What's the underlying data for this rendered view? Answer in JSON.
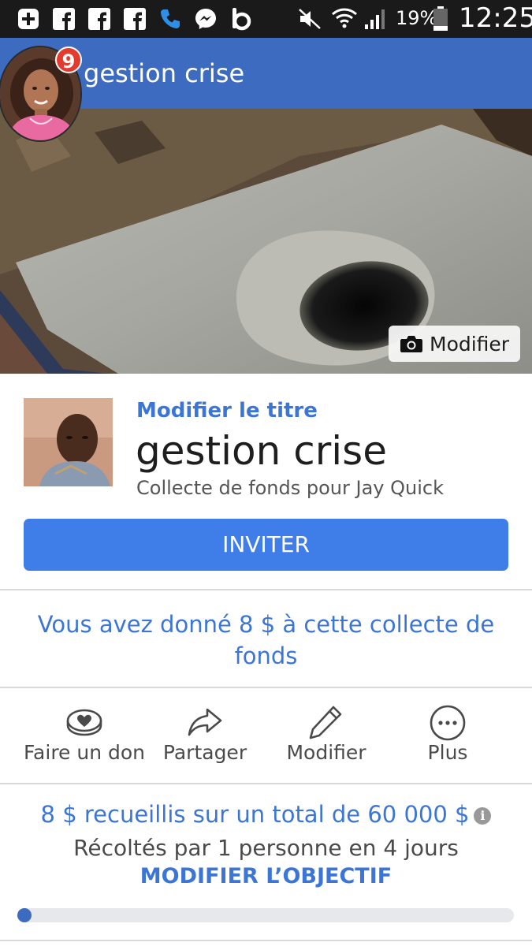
{
  "status_bar": {
    "battery": "19%",
    "time": "12:25",
    "icons": [
      "add-icon",
      "facebook-icon",
      "facebook-icon",
      "facebook-icon",
      "phone-icon",
      "messenger-icon",
      "b-app-icon",
      "mute-icon",
      "wifi-icon",
      "signal-icon",
      "battery-icon"
    ]
  },
  "header": {
    "title": "gestion crise",
    "badge_count": "9"
  },
  "cover": {
    "edit_label": "Modifier"
  },
  "fundraiser": {
    "edit_title_link": "Modifier le titre",
    "title": "gestion crise",
    "subtitle": "Collecte de fonds pour Jay Quick"
  },
  "invite_button": "INVITER",
  "donation_note": "Vous avez donné 8 $ à cette collecte de fonds",
  "actions": [
    {
      "label": "Faire un don",
      "icon": "donate-icon"
    },
    {
      "label": "Partager",
      "icon": "share-icon"
    },
    {
      "label": "Modifier",
      "icon": "pencil-icon"
    },
    {
      "label": "Plus",
      "icon": "more-icon"
    }
  ],
  "goal": {
    "summary": "8 $ recueillis sur un total de 60 000 $",
    "info_icon": "info-icon",
    "collected_by": "Récoltés par 1 personne en 4 jours",
    "edit_goal_link": "MODIFIER L’OBJECTIF",
    "progress_fraction": 0.000133
  },
  "colors": {
    "header_blue": "#3d6bbf",
    "button_blue": "#3f7ee8",
    "link_blue": "#3b75d6",
    "badge_red": "#e33b2e"
  }
}
